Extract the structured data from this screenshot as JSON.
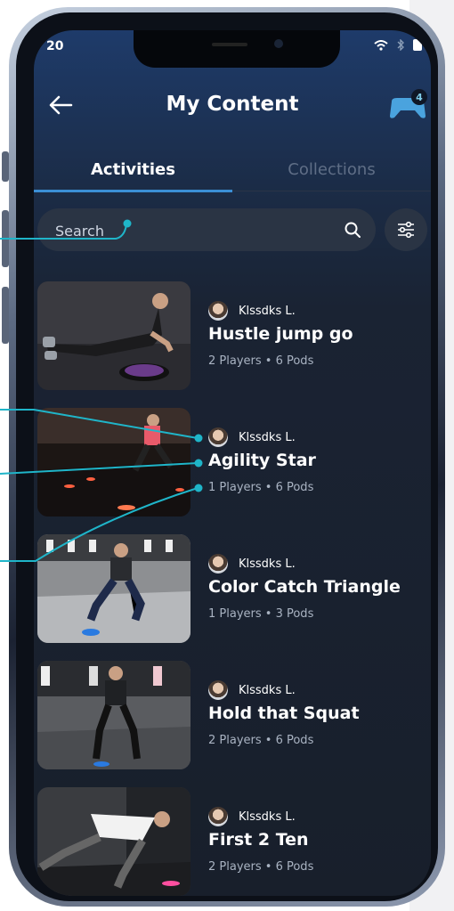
{
  "status_bar": {
    "time": "20",
    "wifi": "wifi-icon",
    "bluetooth": "bluetooth-icon",
    "battery": "battery-icon"
  },
  "header": {
    "title": "My Content",
    "back_icon": "arrow-left-icon",
    "controller_icon": "game-controller-icon",
    "badge_count": "4"
  },
  "tabs": [
    {
      "label": "Activities",
      "active": true
    },
    {
      "label": "Collections",
      "active": false
    }
  ],
  "search": {
    "placeholder": "Search",
    "icon": "search-icon"
  },
  "filter": {
    "icon": "sliders-icon"
  },
  "activities": [
    {
      "author": "Klssdks L.",
      "title": "Hustle jump go",
      "players": "2 Players",
      "pods": "6 Pods"
    },
    {
      "author": "Klssdks L.",
      "title": "Agility Star",
      "players": "1 Players",
      "pods": "6 Pods"
    },
    {
      "author": "Klssdks L.",
      "title": "Color Catch Triangle",
      "players": "1 Players",
      "pods": "3 Pods"
    },
    {
      "author": "Klssdks L.",
      "title": "Hold that Squat",
      "players": "2 Players",
      "pods": "6 Pods"
    },
    {
      "author": "Klssdks L.",
      "title": "First 2 Ten",
      "players": "2 Players",
      "pods": "6 Pods"
    }
  ],
  "colors": {
    "accent": "#3b8fd6",
    "callout": "#1fb5c9",
    "background": "#181f2b"
  }
}
